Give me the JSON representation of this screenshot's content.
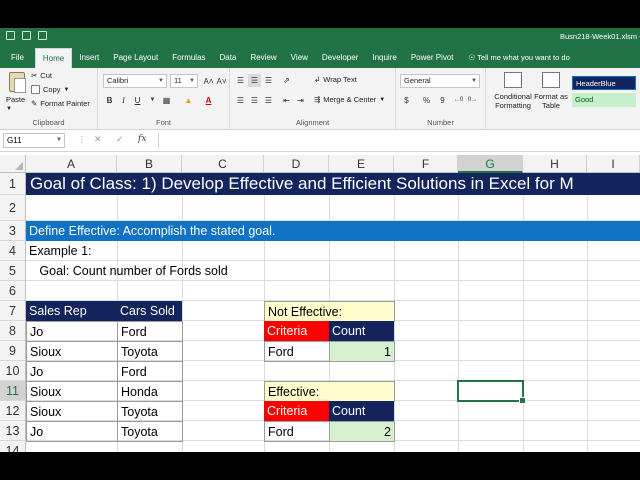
{
  "window": {
    "filename": "Busn218-Week01.xlsm - E"
  },
  "tabs": [
    "File",
    "Home",
    "Insert",
    "Page Layout",
    "Formulas",
    "Data",
    "Review",
    "View",
    "Developer",
    "Inquire",
    "Power Pivot"
  ],
  "active_tab": "Home",
  "tell_me": "Tell me what you want to do",
  "ribbon": {
    "clipboard": {
      "paste": "Paste",
      "cut": "Cut",
      "copy": "Copy",
      "format_painter": "Format Painter",
      "label": "Clipboard"
    },
    "font": {
      "name": "Calibri",
      "size": "11",
      "bold": "B",
      "italic": "I",
      "underline": "U",
      "label": "Font",
      "font_color_letter": "A"
    },
    "alignment": {
      "wrap_text": "Wrap Text",
      "merge_center": "Merge & Center",
      "label": "Alignment"
    },
    "number": {
      "format": "General",
      "currency": "$",
      "percent": "%",
      "comma": "9",
      "label": "Number"
    },
    "styles": {
      "conditional_formatting": "Conditional Formatting",
      "format_as_table": "Format as Table",
      "style1": "HeaderBlue",
      "style2": "Good"
    }
  },
  "formula_bar": {
    "name_box": "G11",
    "fx": "fx",
    "value": ""
  },
  "columns": [
    "A",
    "B",
    "C",
    "D",
    "E",
    "F",
    "G",
    "H",
    "I"
  ],
  "rows": [
    "1",
    "2",
    "3",
    "4",
    "5",
    "6",
    "7",
    "8",
    "9",
    "10",
    "11",
    "12",
    "13",
    "14"
  ],
  "selected_cell": "G11",
  "sheet": {
    "title": "Goal of Class: 1) Develop Effective and Efficient Solutions in Excel for M",
    "define": "Define Effective: Accomplish the stated goal.",
    "example": "Example 1:",
    "goal": "   Goal: Count number of Fords sold",
    "table": {
      "headers": [
        "Sales Rep",
        "Cars Sold"
      ],
      "rows": [
        [
          "Jo",
          "Ford"
        ],
        [
          "Sioux",
          "Toyota"
        ],
        [
          "Jo",
          "Ford"
        ],
        [
          "Sioux",
          "Honda"
        ],
        [
          "Sioux",
          "Toyota"
        ],
        [
          "Jo",
          "Toyota"
        ]
      ]
    },
    "not_effective": {
      "label": "Not Effective:",
      "headers": [
        "Criteria",
        "Count"
      ],
      "criteria": "Ford",
      "count": "1"
    },
    "effective": {
      "label": "Effective:",
      "headers": [
        "Criteria",
        "Count"
      ],
      "criteria": "Ford",
      "count": "2"
    }
  },
  "colors": {
    "excel_green": "#217346",
    "title_navy": "#14245c",
    "band_blue": "#0f72c4",
    "criteria_red": "#ff0000",
    "label_yellow": "#fffdcc",
    "count_green": "#d7f1cf"
  }
}
